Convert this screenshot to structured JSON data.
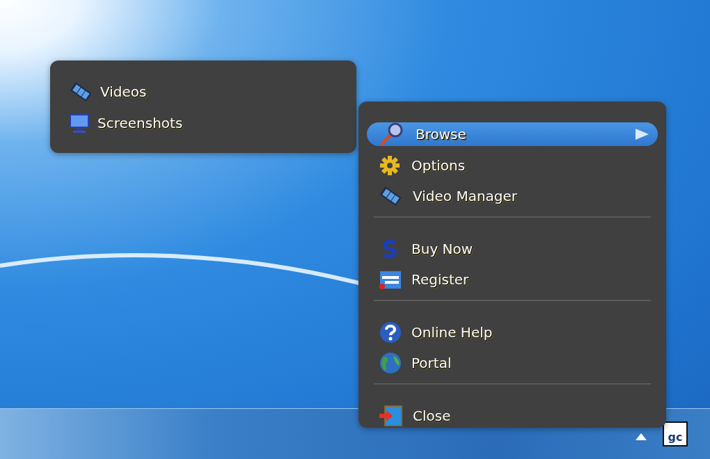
{
  "submenu": {
    "items": [
      {
        "label": "Videos"
      },
      {
        "label": "Screenshots"
      }
    ]
  },
  "menu": {
    "groups": [
      {
        "items": [
          {
            "label": "Browse",
            "selected": true,
            "has_submenu": true
          },
          {
            "label": "Options",
            "selected": false,
            "has_submenu": false
          },
          {
            "label": "Video Manager",
            "selected": false,
            "has_submenu": false
          }
        ]
      },
      {
        "items": [
          {
            "label": "Buy Now",
            "selected": false,
            "has_submenu": false
          },
          {
            "label": "Register",
            "selected": false,
            "has_submenu": false
          }
        ]
      },
      {
        "items": [
          {
            "label": "Online Help",
            "selected": false,
            "has_submenu": false
          },
          {
            "label": "Portal",
            "selected": false,
            "has_submenu": false
          }
        ]
      },
      {
        "items": [
          {
            "label": "Close",
            "selected": false,
            "has_submenu": false
          }
        ]
      }
    ]
  },
  "tray": {
    "app_label": "gc"
  }
}
